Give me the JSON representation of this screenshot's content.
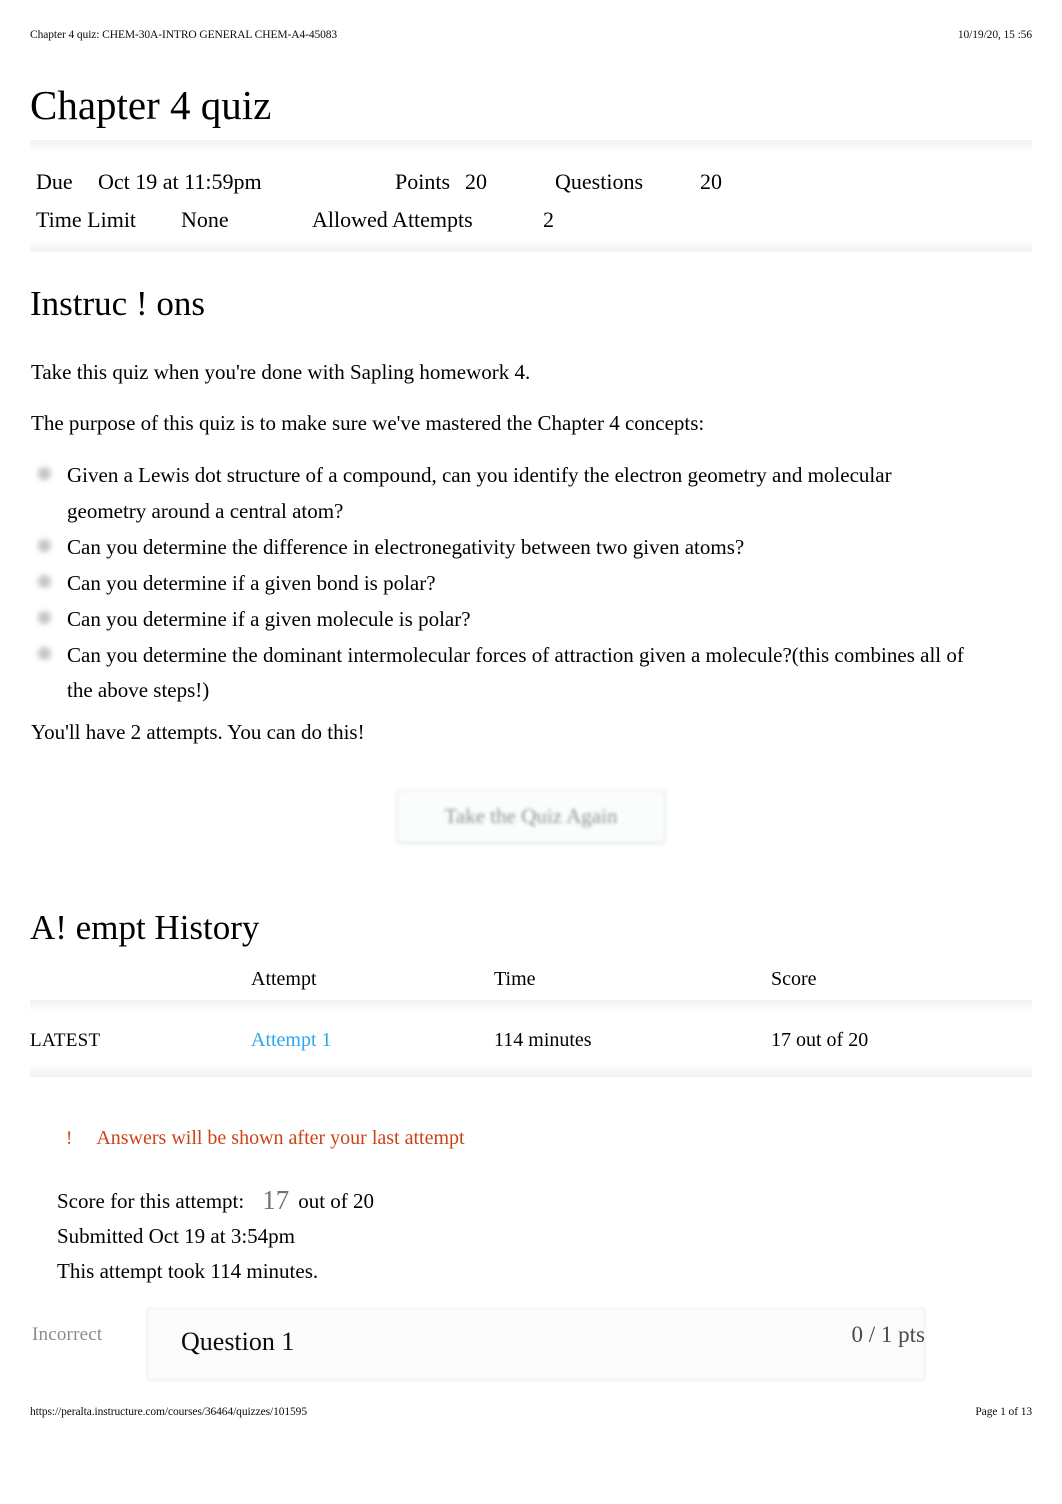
{
  "print_header": {
    "title": "Chapter 4 quiz: CHEM-30A-INTRO GENERAL CHEM-A4-45083",
    "timestamp": "10/19/20, 15  :56"
  },
  "print_footer": {
    "url": "https://peralta.instructure.com/courses/36464/quizzes/101595",
    "page_label": "Page 1 of 13"
  },
  "quiz": {
    "title": "Chapter 4 quiz",
    "meta": {
      "due_label": "Due",
      "due_value": "Oct 19 at 11:59pm",
      "points_label": "Points",
      "points_value": "20",
      "questions_label": "Questions",
      "questions_value": "20",
      "time_limit_label": "Time Limit",
      "time_limit_value": "None",
      "allowed_attempts_label": "Allowed Attempts",
      "allowed_attempts_value": "2"
    }
  },
  "instructions": {
    "heading": "Instruc ! ons",
    "intro_1": "Take this quiz when you're done with Sapling homework 4.",
    "intro_2": "The purpose of this quiz is to make sure we've mastered the Chapter 4 concepts:",
    "concepts": [
      "Given a Lewis dot structure of a compound, can you identify the electron geometry and molecular geometry around a central atom?",
      "Can you determine the difference in electronegativity between two given atoms?",
      "Can you determine if a given bond is polar?",
      "Can you determine if a given molecule is polar?",
      "Can you determine the dominant intermolecular forces of attraction given a molecule?(this combines all of the above steps!)"
    ],
    "closing": "You'll have 2 attempts. You can do this!"
  },
  "actions": {
    "retake_label": "Take the Quiz Again"
  },
  "attempt_history": {
    "heading": "A!  empt History",
    "columns": [
      "",
      "Attempt",
      "Time",
      "Score"
    ],
    "rows": [
      {
        "latest": "LATEST",
        "attempt": "Attempt 1",
        "time": "114 minutes",
        "score": "17 out of 20"
      }
    ]
  },
  "attempt_detail": {
    "warning_icon": "!",
    "warning_text": "Answers will be shown after your last attempt",
    "score_label": "Score for this attempt:",
    "score_value": "17",
    "score_suffix": "out of 20",
    "submitted": "Submitted Oct 19 at 3:54pm",
    "duration": "This attempt took 114 minutes."
  },
  "question": {
    "status": "Incorrect",
    "title": "Question 1",
    "points": "0 / 1 pts"
  },
  "colors": {
    "link_blue": "#2aa8f0",
    "warning_orange": "#ca4418",
    "muted_gray": "#8c8c8c"
  }
}
